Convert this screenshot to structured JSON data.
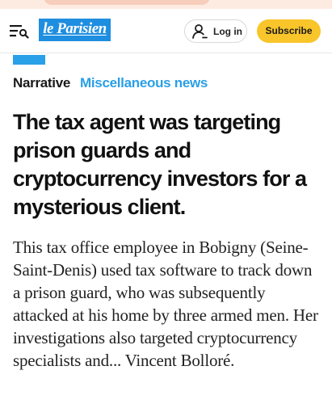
{
  "header": {
    "logo_text": "le Parisien",
    "login_label": "Log in",
    "subscribe_label": "Subscribe",
    "menu_icon": "menu-search-icon",
    "user_icon": "user-icon"
  },
  "article": {
    "tag_type": "Narrative",
    "tag_category": "Miscellaneous news",
    "headline": "The tax agent was targeting prison guards and cryptocurrency investors for a mysterious client.",
    "lede": "This tax office employee in Bobigny (Seine-Saint-Denis) used tax software to track down a prison guard, who was subsequently attacked at his home by three armed men. Her investigations also targeted cryptocurrency specialists and... Vincent Bolloré."
  },
  "colors": {
    "brand_blue": "#1e8ee0",
    "category_blue": "#2a9fe6",
    "subscribe_yellow": "#f8c52a",
    "top_band": "#fdebe2"
  }
}
